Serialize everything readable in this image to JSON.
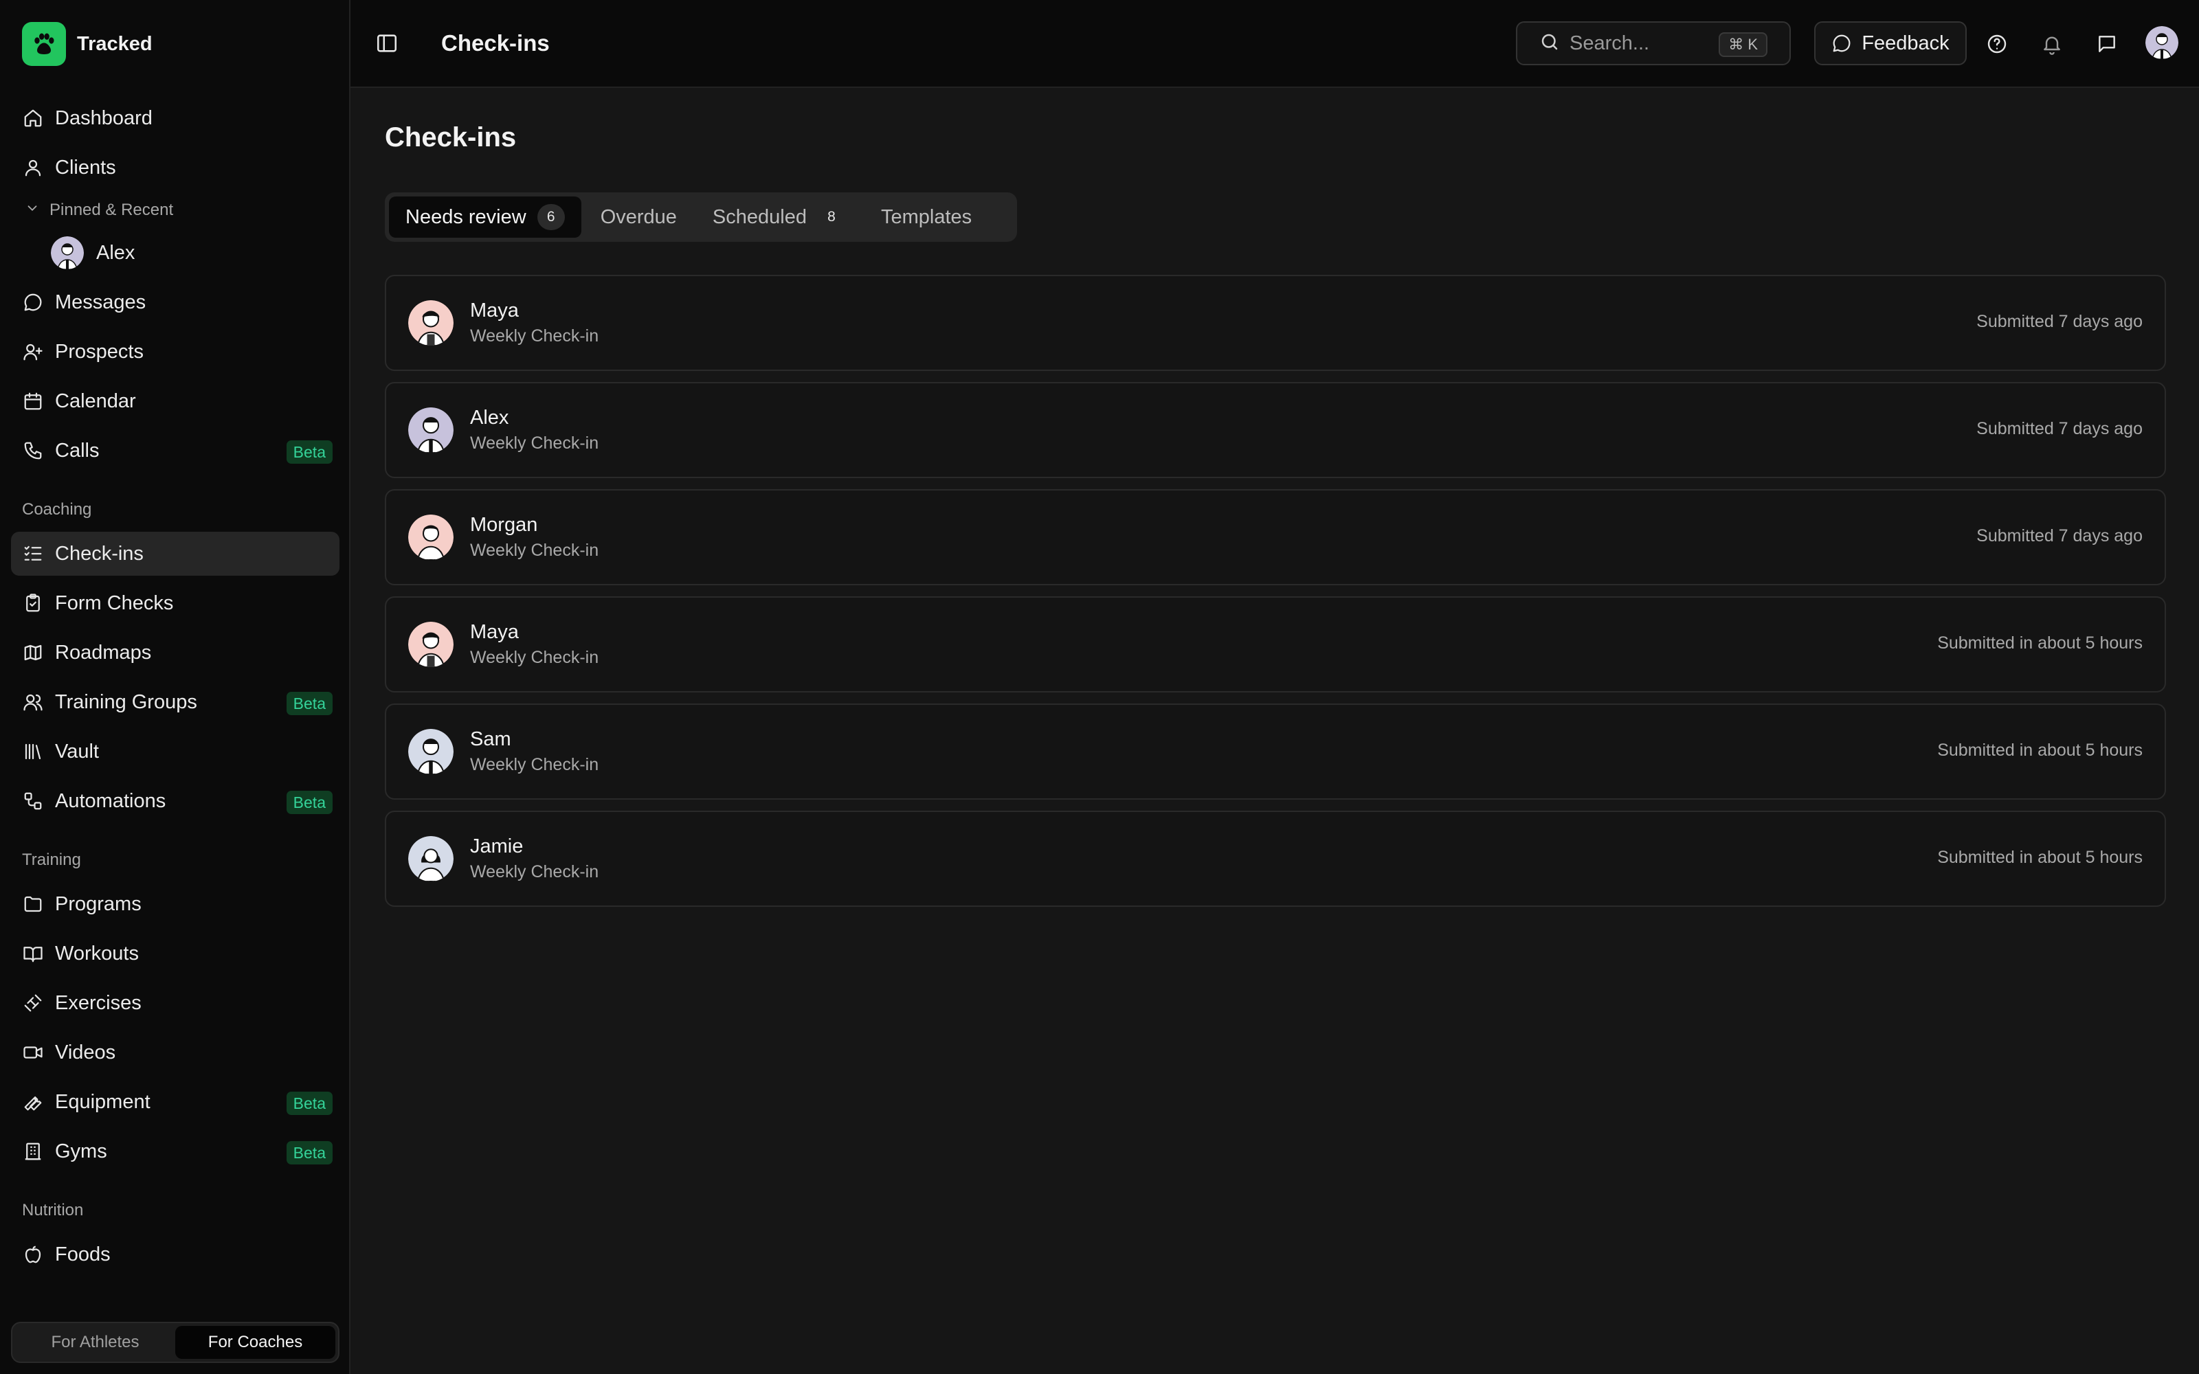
{
  "app": {
    "name": "Tracked"
  },
  "sidebar": {
    "main_items": [
      {
        "label": "Dashboard",
        "icon": "home-icon"
      },
      {
        "label": "Clients",
        "icon": "user-icon"
      }
    ],
    "pinned_header": "Pinned & Recent",
    "pinned_items": [
      {
        "label": "Alex"
      }
    ],
    "main_items2": [
      {
        "label": "Messages",
        "icon": "message-icon"
      },
      {
        "label": "Prospects",
        "icon": "user-plus-icon"
      },
      {
        "label": "Calendar",
        "icon": "calendar-icon"
      },
      {
        "label": "Calls",
        "icon": "phone-icon",
        "badge": "Beta"
      }
    ],
    "sections": [
      {
        "label": "Coaching",
        "items": [
          {
            "label": "Check-ins",
            "icon": "list-check-icon",
            "active": true
          },
          {
            "label": "Form Checks",
            "icon": "clipboard-check-icon"
          },
          {
            "label": "Roadmaps",
            "icon": "map-icon"
          },
          {
            "label": "Training Groups",
            "icon": "users-icon",
            "badge": "Beta"
          },
          {
            "label": "Vault",
            "icon": "library-icon"
          },
          {
            "label": "Automations",
            "icon": "workflow-icon",
            "badge": "Beta"
          }
        ]
      },
      {
        "label": "Training",
        "items": [
          {
            "label": "Programs",
            "icon": "folder-icon"
          },
          {
            "label": "Workouts",
            "icon": "book-icon"
          },
          {
            "label": "Exercises",
            "icon": "dumbbell-icon"
          },
          {
            "label": "Videos",
            "icon": "video-icon"
          },
          {
            "label": "Equipment",
            "icon": "wrench-icon",
            "badge": "Beta"
          },
          {
            "label": "Gyms",
            "icon": "building-icon",
            "badge": "Beta"
          }
        ]
      },
      {
        "label": "Nutrition",
        "items": [
          {
            "label": "Foods",
            "icon": "apple-icon"
          }
        ]
      }
    ],
    "switcher": {
      "athletes": "For Athletes",
      "coaches": "For Coaches"
    }
  },
  "topbar": {
    "title": "Check-ins",
    "search_placeholder": "Search...",
    "search_shortcut": "⌘ K",
    "feedback_label": "Feedback"
  },
  "main": {
    "title": "Check-ins",
    "tabs": [
      {
        "label": "Needs review",
        "count": "6",
        "active": true
      },
      {
        "label": "Overdue",
        "count": ""
      },
      {
        "label": "Scheduled",
        "count": "8"
      },
      {
        "label": "Templates",
        "count": ""
      }
    ],
    "checkins": [
      {
        "name": "Maya",
        "type": "Weekly Check-in",
        "submitted": "Submitted 7 days ago"
      },
      {
        "name": "Alex",
        "type": "Weekly Check-in",
        "submitted": "Submitted 7 days ago"
      },
      {
        "name": "Morgan",
        "type": "Weekly Check-in",
        "submitted": "Submitted 7 days ago"
      },
      {
        "name": "Maya",
        "type": "Weekly Check-in",
        "submitted": "Submitted in about 5 hours"
      },
      {
        "name": "Sam",
        "type": "Weekly Check-in",
        "submitted": "Submitted in about 5 hours"
      },
      {
        "name": "Jamie",
        "type": "Weekly Check-in",
        "submitted": "Submitted in about 5 hours"
      }
    ]
  },
  "colors": {
    "accent": "#22c55e",
    "beta_bg": "#0f3d22",
    "beta_text": "#34d399"
  }
}
